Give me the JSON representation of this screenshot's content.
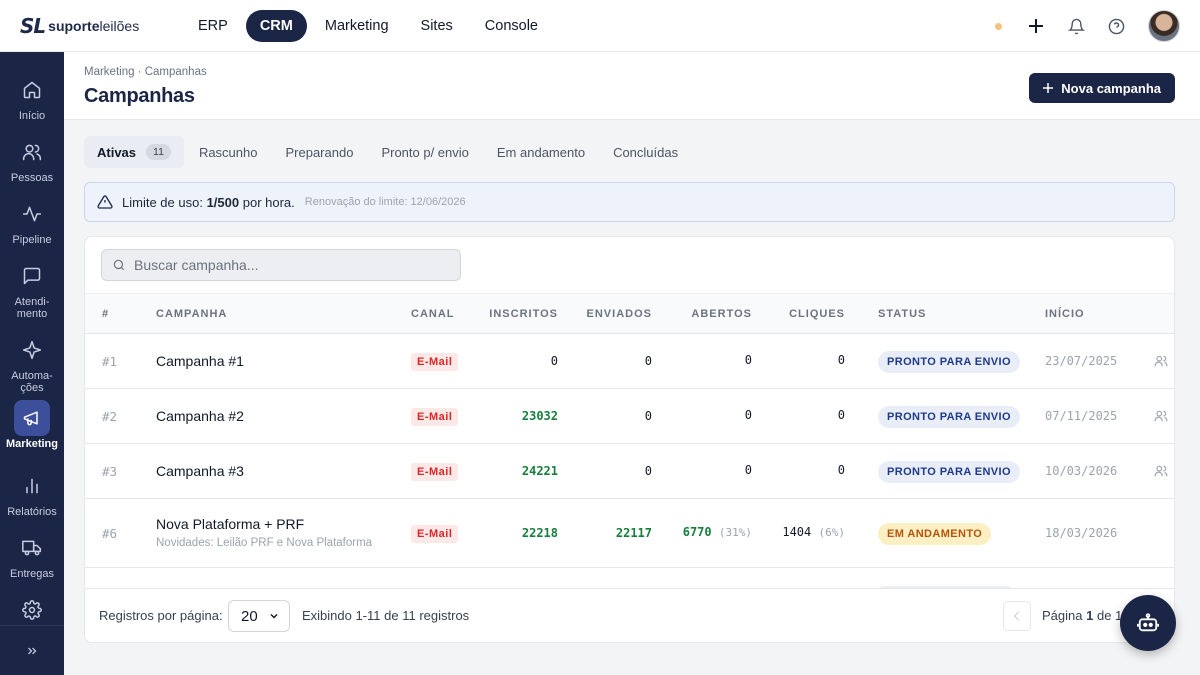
{
  "brand": {
    "mark": "SL",
    "name_bold": "suporte",
    "name_rest": "leilões"
  },
  "nav": [
    {
      "label": "ERP",
      "active": false
    },
    {
      "label": "CRM",
      "active": true
    },
    {
      "label": "Marketing",
      "active": false
    },
    {
      "label": "Sites",
      "active": false
    },
    {
      "label": "Console",
      "active": false
    }
  ],
  "topbar_icons": [
    "status-dot",
    "plus-icon",
    "bell-icon",
    "help-icon",
    "avatar"
  ],
  "sidebar": {
    "items": [
      {
        "label": "Início",
        "icon": "home-icon"
      },
      {
        "label": "Pessoas",
        "icon": "users-icon"
      },
      {
        "label": "Pipeline",
        "icon": "activity-icon"
      },
      {
        "label": "Atendi-\nmento",
        "icon": "chat-icon"
      },
      {
        "label": "Automa-\nções",
        "icon": "sparkle-icon"
      },
      {
        "label": "Marketing",
        "icon": "megaphone-icon",
        "active": true
      },
      {
        "label": "Relatórios",
        "icon": "bar-chart-icon"
      },
      {
        "label": "Entregas",
        "icon": "truck-icon"
      },
      {
        "label": "",
        "icon": "gear-icon"
      }
    ]
  },
  "header": {
    "breadcrumb": "Marketing · Campanhas",
    "title": "Campanhas",
    "new_button": "Nova campanha"
  },
  "tabs": [
    {
      "label": "Ativas",
      "count": "11",
      "active": true
    },
    {
      "label": "Rascunho"
    },
    {
      "label": "Preparando"
    },
    {
      "label": "Pronto p/ envio"
    },
    {
      "label": "Em andamento"
    },
    {
      "label": "Concluídas"
    }
  ],
  "alert": {
    "prefix": "Limite de uso:",
    "value": "1/500",
    "suffix": "por hora.",
    "renewal": "Renovação do limite: 12/06/2026"
  },
  "search": {
    "placeholder": "Buscar campanha..."
  },
  "table": {
    "headers": [
      "#",
      "CAMPANHA",
      "CANAL",
      "INSCRITOS",
      "ENVIADOS",
      "ABERTOS",
      "CLIQUES",
      "STATUS",
      "INÍCIO"
    ],
    "rows": [
      {
        "id": "#1",
        "name": "Campanha #1",
        "sub": "",
        "channel": "E-Mail",
        "subscribers": "0",
        "sent": "0",
        "opened": "0",
        "opened_pct": "",
        "clicks": "0",
        "clicks_pct": "",
        "status": "PRONTO PARA ENVIO",
        "status_type": "ready",
        "start": "23/07/2025",
        "has_icon": true
      },
      {
        "id": "#2",
        "name": "Campanha #2",
        "sub": "",
        "channel": "E-Mail",
        "subscribers": "23032",
        "sent": "0",
        "opened": "0",
        "opened_pct": "",
        "clicks": "0",
        "clicks_pct": "",
        "status": "PRONTO PARA ENVIO",
        "status_type": "ready",
        "start": "07/11/2025",
        "has_icon": true
      },
      {
        "id": "#3",
        "name": "Campanha #3",
        "sub": "",
        "channel": "E-Mail",
        "subscribers": "24221",
        "sent": "0",
        "opened": "0",
        "opened_pct": "",
        "clicks": "0",
        "clicks_pct": "",
        "status": "PRONTO PARA ENVIO",
        "status_type": "ready",
        "start": "10/03/2026",
        "has_icon": true
      },
      {
        "id": "#6",
        "name": "Nova Plataforma + PRF",
        "sub": "Novidades: Leilão PRF e Nova Plataforma",
        "channel": "E-Mail",
        "subscribers": "22218",
        "sent": "22117",
        "opened": "6770",
        "opened_pct": "(31%)",
        "clicks": "1404",
        "clicks_pct": "(6%)",
        "status": "EM ANDAMENTO",
        "status_type": "progress",
        "start": "18/03/2026",
        "has_icon": false
      }
    ]
  },
  "footer": {
    "per_page_label": "Registros por página:",
    "per_page_value": "20",
    "showing": "Exibindo 1-11 de 11 registros",
    "page_label": "Página",
    "page_current": "1",
    "page_of": "de 1"
  }
}
